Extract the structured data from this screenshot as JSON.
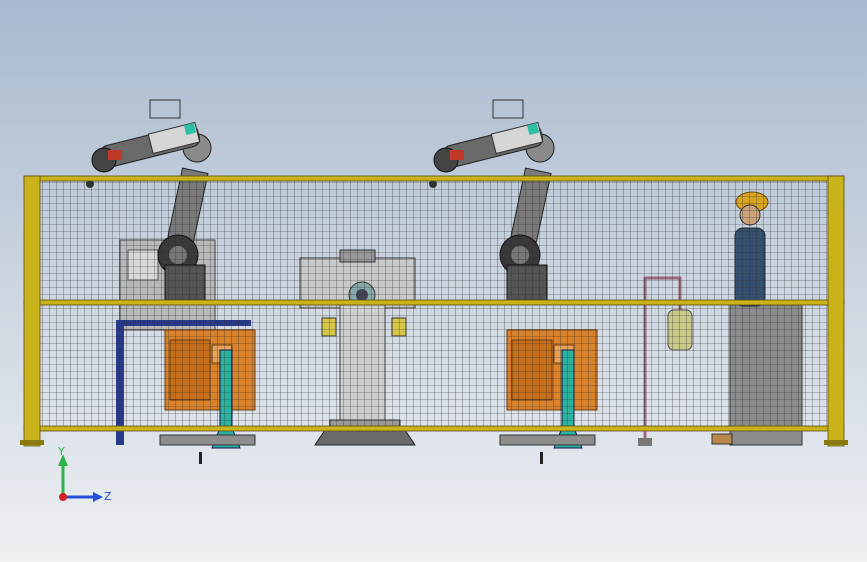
{
  "viewport": {
    "background_top": "#a8b9cf",
    "background_bottom": "#eef0f3"
  },
  "colors": {
    "fence_frame": "#c9b21a",
    "fence_mesh": "#2a2a2a",
    "robot_body": "#4a4a4a",
    "robot_accent": "#c0392b",
    "robot_highlight": "#2bbfa4",
    "controller_cabinet": "#d9822b",
    "pedestal": "#2bb3a0",
    "operator_helmet": "#d9a520",
    "operator_suit": "#34506e",
    "workbench": "#8c8c8c"
  },
  "scene": {
    "robot_cells": [
      {
        "id": "left",
        "robot": "industrial-robot-arm",
        "controller": "welding-power-source"
      },
      {
        "id": "right",
        "robot": "industrial-robot-arm",
        "controller": "welding-power-source"
      }
    ],
    "center_fixture": "rotary-positioner",
    "operator": "operator-figure",
    "enclosure": "safety-fence"
  },
  "triad": {
    "y_label": "Y",
    "z_label": "Z",
    "y_color": "#2db34a",
    "z_color": "#2450d8",
    "origin_color": "#d42020"
  }
}
